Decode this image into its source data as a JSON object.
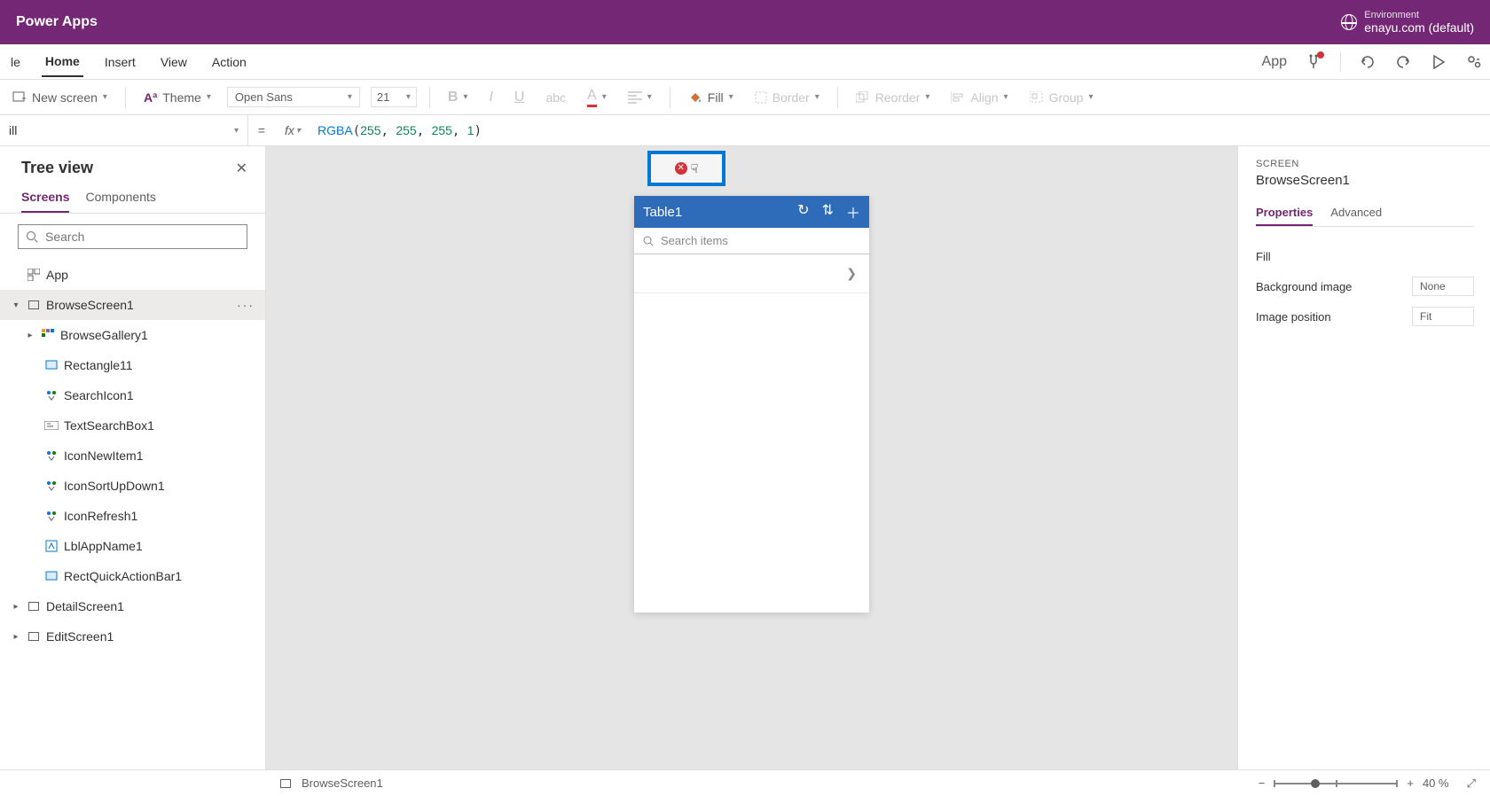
{
  "app_title": "Power Apps",
  "environment": {
    "label": "Environment",
    "name": "enayu.com (default)"
  },
  "ribbon": {
    "tabs": [
      "le",
      "Home",
      "Insert",
      "View",
      "Action"
    ],
    "active": "Home",
    "app_label": "App"
  },
  "toolbar": {
    "new_screen": "New screen",
    "theme": "Theme",
    "font": "Open Sans",
    "font_size": "21",
    "fill": "Fill",
    "border": "Border",
    "reorder": "Reorder",
    "align": "Align",
    "group": "Group"
  },
  "formula": {
    "property": "ill",
    "fn": "RGBA",
    "args": [
      "255",
      "255",
      "255",
      "1"
    ]
  },
  "tree": {
    "title": "Tree view",
    "tabs": [
      "Screens",
      "Components"
    ],
    "search_placeholder": "Search",
    "app_node": "App",
    "items": [
      {
        "name": "BrowseScreen1",
        "children": [
          {
            "name": "BrowseGallery1"
          },
          {
            "name": "Rectangle11"
          },
          {
            "name": "SearchIcon1"
          },
          {
            "name": "TextSearchBox1"
          },
          {
            "name": "IconNewItem1"
          },
          {
            "name": "IconSortUpDown1"
          },
          {
            "name": "IconRefresh1"
          },
          {
            "name": "LblAppName1"
          },
          {
            "name": "RectQuickActionBar1"
          }
        ]
      },
      {
        "name": "DetailScreen1"
      },
      {
        "name": "EditScreen1"
      }
    ]
  },
  "canvas": {
    "header_title": "Table1",
    "search_placeholder": "Search items"
  },
  "props": {
    "section": "SCREEN",
    "name": "BrowseScreen1",
    "tabs": [
      "Properties",
      "Advanced"
    ],
    "rows": {
      "fill": "Fill",
      "bg_image": "Background image",
      "bg_image_val": "None",
      "img_pos": "Image position",
      "img_pos_val": "Fit"
    }
  },
  "status": {
    "breadcrumb": "BrowseScreen1",
    "zoom": "40",
    "zoom_unit": "%"
  }
}
